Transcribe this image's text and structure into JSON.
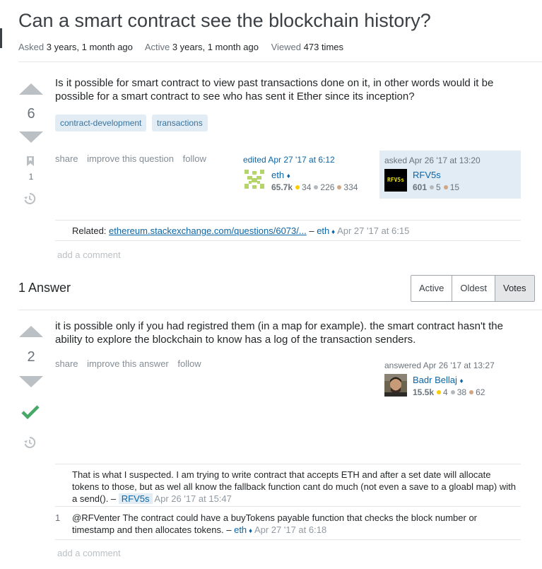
{
  "question": {
    "title": "Can a smart contract see the blockchain history?",
    "meta": {
      "asked_label": "Asked",
      "asked_value": "3 years, 1 month ago",
      "active_label": "Active",
      "active_value": "3 years, 1 month ago",
      "viewed_label": "Viewed",
      "viewed_value": "473 times"
    },
    "score": "6",
    "bookmark_count": "1",
    "body_line1": "Is it possible for smart contract to view past transactions done on it, in other words would it be",
    "body_line2": "possible for a smart contract to see who has sent it Ether since its inception?",
    "tags": [
      "contract-development",
      "transactions"
    ],
    "menu": {
      "share": "share",
      "improve": "improve this question",
      "follow": "follow"
    },
    "edited": {
      "action": "edited Apr 27 '17 at 6:12",
      "user": "eth",
      "rep": "65.7k",
      "gold": "34",
      "silver": "226",
      "bronze": "334"
    },
    "asked": {
      "action": "asked Apr 26 '17 at 13:20",
      "user": "RFV5s",
      "rep": "601",
      "silver": "5",
      "bronze": "15",
      "avatar_text": "RFV5s"
    },
    "comment": {
      "prefix": "Related:",
      "link": "ethereum.stackexchange.com/questions/6073/...",
      "dash": "–",
      "user": "eth",
      "date": "Apr 27 '17 at 6:15"
    },
    "add_comment": "add a comment"
  },
  "answers_header": {
    "count_label": "1 Answer",
    "sort_tabs": [
      "Active",
      "Oldest",
      "Votes"
    ]
  },
  "answer": {
    "score": "2",
    "body_line1": "it is possible only if you had registred them (in a map for example). the smart contract hasn't the",
    "body_line2": "ability to explore the blockchain to know has a log of the transaction senders.",
    "menu": {
      "share": "share",
      "improve": "improve this answer",
      "follow": "follow"
    },
    "answered": {
      "action": "answered Apr 26 '17 at 13:27",
      "user": "Badr Bellaj",
      "rep": "15.5k",
      "gold": "4",
      "silver": "38",
      "bronze": "62"
    },
    "comments": [
      {
        "score": "",
        "line1": "That is what I suspected. I am trying to write contract that accepts ETH and after a set date will allocate",
        "line2": "tokens to those, but as wel all know the fallback function cant do much (not even a save to a gloabl map) with",
        "line3": "a send(). –",
        "user": "RFV5s",
        "date": "Apr 26 '17 at 15:47"
      },
      {
        "score": "1",
        "line1": "@RFVenter The contract could have a buyTokens payable function that checks the block number or",
        "line2": "timestamp and then allocates tokens. –",
        "user": "eth",
        "date": "Apr 27 '17 at 6:18"
      }
    ],
    "add_comment": "add a comment"
  },
  "colors": {
    "link": "#0c65a5",
    "accepted": "#48a868",
    "vote_arrow": "#bbc0c4",
    "tag_bg": "#e1ecf4",
    "tag_text": "#39739d"
  }
}
